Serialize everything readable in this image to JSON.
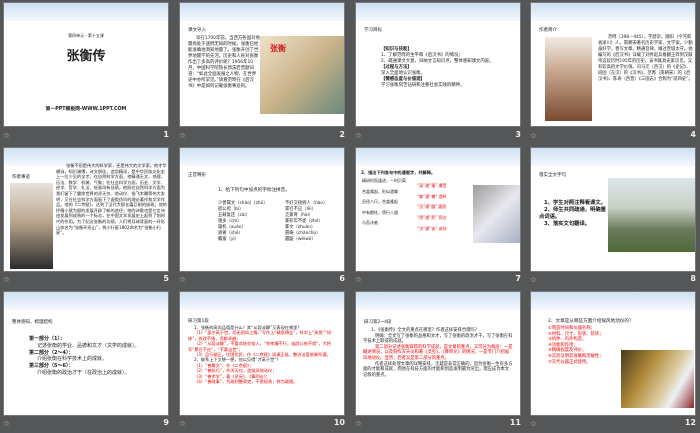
{
  "slides": [
    {
      "number": "1",
      "subtitle": "第四单元 · 第十五课",
      "title": "张衡传",
      "footer": "第一PPT模板网-WWW.1PPT.COM"
    },
    {
      "number": "2",
      "label": "课文导入",
      "text": "早在1700年前，当西方各国对地震尚处于迷惘无知的时候，张衡已经能准确地测知地震了。张衡开创了世界地震学的先河。历史和人民对张衡作出了多高的评价呢？1956年10月，中国科学院院长郭沫若曾题词道：“如此全面发展之人物，在世界史中亦所罕见。”请看范晔在《后汉书》中是如何记载张衡事迹的。",
      "image_caption": "张衡"
    },
    {
      "number": "3",
      "label": "学习目标",
      "lines": [
        "【知识与技能】",
        "1、了解范晔的生平和《后汉书》的情况；",
        "2、疏通课文大意，归纳文言知识点，整体感知课文内容。",
        "【过程与方法】",
        "深入全面地认识张衡。",
        "【情感态度与价值观】",
        "学习张衡刻苦钻研和注重社会实践的精神。"
      ]
    },
    {
      "number": "4",
      "label": "作者简介",
      "text": "范晔（398－445），字蔚宗，顺阳（今河南省淅川）人。南朝宋著名历史学家、文学家。少勤奋好学，善写文章，精通音律，做过宣城太守。他编写的《后汉书》详载了刘秀起兵推翻王莽到汉献帝这段历时195年的历史。该书既具史家识见，又有较高的文学价值。司马迁（西汉）的《史记》、班固（东汉）的《汉书》、范晔（南朝宋）的《后汉书》、陈寿（西晋）《三国志》合称为“前四史”。"
    },
    {
      "number": "5",
      "label": "作者事迹",
      "text": "张衡不但是伟大的科学家，还是伟大的文学家。他才华横溢，知识渊博，诗文俱佳，造诣精深，是中华民族文化史上一位少见的全才。在自然科学方面，他精通天文、地理、历法、数学、机械、气象；在社会科学方面，历史、文学、经学、哲学、礼法、绘画均有佳绩。他既在自然科学方面为我们留下了震惊世界的浑天仪、地动仪、指飞木雕等伟大发明，又在社会科学方面留下了虚假伪问的理论著作和文学作品。他的《二京赋》，达到了汉代大赋长篇巨制的极致；他的抒情小赋为赋的发展开辟了新的途径；他的诗歌也是七言诗由发展到成熟的一个标志，在中国文学发展史上起到了划时代的作用。为了纪念张衡的功绩，人们将月球背面的一环形山命名为“张衡环形山”，将小行星1802命名为“张衡小行星”。"
    },
    {
      "number": "6",
      "label": "正音释形",
      "question": "1、给下列句中加点的字标注拼音。",
      "left": [
        "少善属文（shǎo）(zhǔ）",
        "欲公府（bì）",
        "五载复还（zài）",
        "遁多（chí）",
        "璇机（xuán）",
        "骄奢（shē）",
        "瞻富（yì）"
      ],
      "right": [
        "不好交接俗人（hào）",
        "累召不应（lěi）",
        "乏篆骨（hài）",
        "篆积年不徙（zhé）",
        "篆文（zhuàn）",
        "愿踌（chánchú）",
        "龌龊（wéiwò）"
      ]
    },
    {
      "number": "7",
      "question": "2、指出下列各句中的通假字，并解释。",
      "items": [
        {
          "q": "精研时而逢进，一时贝离",
          "a": "“离”通“罹” 遭受"
        },
        {
          "q": "合盖隆起，形似酒尊",
          "a": "“尊”通“樽” 酒杯"
        },
        {
          "q": "员径八尺，合盖隆起",
          "a": "“员”通“圆” 圆形"
        },
        {
          "q": "中有都柱，傍行八道",
          "a": "“傍”通“旁” 旁边"
        },
        {
          "q": "与吾决者",
          "a": "“决”通“诀” 诀别"
        }
      ]
    },
    {
      "number": "8",
      "label": "落实全文字句",
      "items": [
        "1、学生对照注释看课文。",
        "2、师生共同疏通，明确重点词语。",
        "3、落实文句翻译。"
      ]
    },
    {
      "number": "9",
      "label": "整体感知，梳理结构",
      "parts": [
        {
          "h": "第一部分（1）：",
          "d": "记述张衡的学业、品德和文才（文学的成就）。"
        },
        {
          "h": "第二部分（2～4）：",
          "d": "介绍张衡在科学技术上的成就。"
        },
        {
          "h": "第三部分（5～6）：",
          "d": "介绍张衡的政治才干（在政治上的成就）。"
        }
      ]
    },
    {
      "number": "10",
      "label": "研习第1段",
      "q1": "1、张衡的高尚品德是什么？其“从容淡静”又表现在哪里？",
      "a1": [
        "（1）“虽才高于世，而无骄尚之情。”写作上“精思傅会”，科学上“致思”“研核”，孜孜不倦，贡献卓越；",
        "（2）“从容淡静”，不喜欢结交俗人，“举孝廉不行，连辟公府不就”，大将军“累召不应”，“不慕当世”；",
        "（3）品行端正，忧国忧民，作《二京赋》讽谏王侯，整治法度收奏所谓。"
      ],
      "q2": "2、联系上下文想一想，何以见得“才高于世”？",
      "a2": [
        "（1）“善属文”，作《二京赋》；",
        "（2）“善机巧”，作浑天仪，造候风地动仪；",
        "（3）“善术学”，著《灵宪》、《算罔论》；",
        "（4）“善政事”，为政则整肃吏，不畏权贵，称为政理。"
      ]
    },
    {
      "number": "11",
      "label": "研习第2~4段",
      "q": "1、《张衡传》全文的重点在哪里？作者这样安排合理吗？",
      "black1": "明确：全文写了张衡的品格和文才，写了张衡的政治才干，写了张衡在科学技术上取得的成就。",
      "red": "第二部分记述张衡取得的科学成就，是文章的重点，又可分为两层：一是概述情况，以及制作浑天仪和著《灵宪》、《算罔论》的情况；一是专门介绍候风地动仪。显然，后者又是第二部分的重点。",
      "black2": "作者这样处理文章的详略安排，无疑是非常正确的，因为张衡一生有多方面的才能和成就，而他在科技方面的才能和创造发明最为突出，理应成为本文记叙的重点。"
    },
    {
      "number": "12",
      "question": "2、文章是从哪些方面介绍候风地动仪的？",
      "items": [
        "①制造时间和仪器名称；",
        "②材料、尺寸、形状、装饰；",
        "③机件、内外构造；",
        "④功能和作用；",
        "⑤精确程度及评价；",
        "⑥实验证明其准确和灵敏性；",
        "⑦交代仪器正式使用。"
      ]
    }
  ]
}
